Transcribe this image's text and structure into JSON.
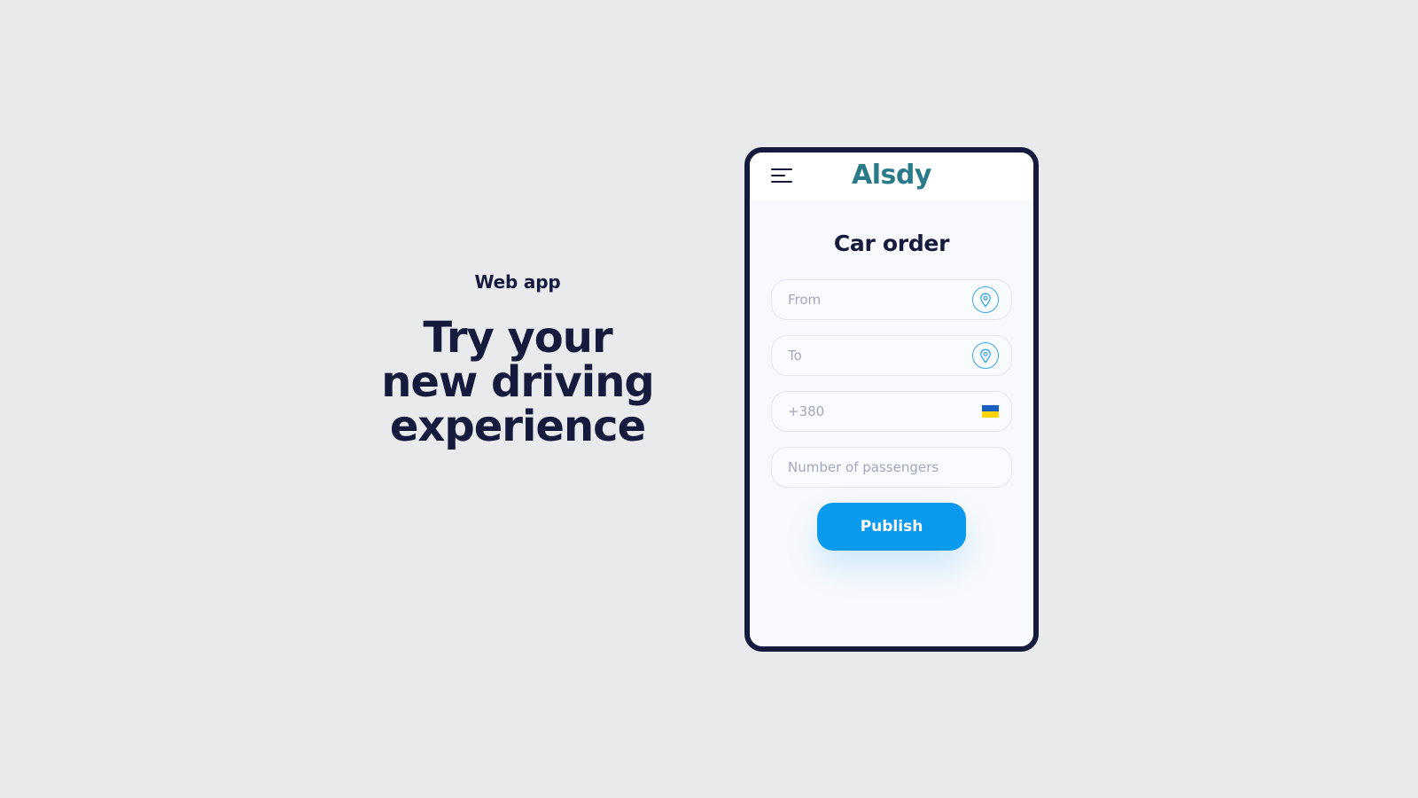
{
  "hero": {
    "eyebrow": "Web app",
    "headline_lines": [
      "Try your",
      "new driving",
      "experience"
    ]
  },
  "app": {
    "logo": "Alsdy",
    "menu_icon": "hamburger-menu-icon",
    "title": "Car order",
    "fields": {
      "from": {
        "placeholder": "From",
        "value": "",
        "icon": "location-pin-icon"
      },
      "to": {
        "placeholder": "To",
        "value": "",
        "icon": "location-pin-icon"
      },
      "phone": {
        "placeholder": "+380",
        "value": "",
        "icon": "ukraine-flag-icon"
      },
      "passengers": {
        "placeholder": "Number of passengers",
        "value": ""
      }
    },
    "publish_label": "Publish"
  },
  "colors": {
    "background": "#e9eaec",
    "text_dark": "#161a3d",
    "logo": "#2b7a89",
    "accent": "#0c9aee",
    "pin": "#3aa6e8",
    "flag_blue": "#1a5fbf",
    "flag_yellow": "#ffd400"
  }
}
